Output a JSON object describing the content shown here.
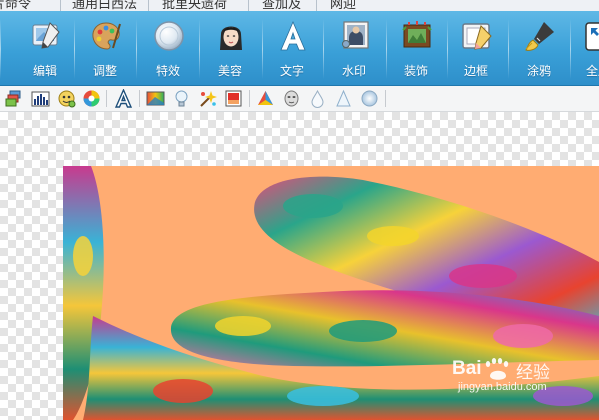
{
  "menu": {
    "items": [
      "片命令",
      "通用白西法",
      "批里央遗荷",
      "查加及",
      "网迎"
    ]
  },
  "toolbar": {
    "buttons": [
      {
        "label": "编辑",
        "icon": "edit-pen-icon"
      },
      {
        "label": "调整",
        "icon": "palette-icon"
      },
      {
        "label": "特效",
        "icon": "effects-lens-icon"
      },
      {
        "label": "美容",
        "icon": "beauty-face-icon"
      },
      {
        "label": "文字",
        "icon": "text-a-icon"
      },
      {
        "label": "水印",
        "icon": "watermark-stamp-icon"
      },
      {
        "label": "装饰",
        "icon": "decoration-frame-icon"
      },
      {
        "label": "边框",
        "icon": "border-frame-icon"
      },
      {
        "label": "涂鸦",
        "icon": "doodle-brush-icon"
      },
      {
        "label": "全屏",
        "icon": "fullscreen-icon"
      }
    ]
  },
  "subtoolbar": {
    "icons": [
      "layers-icon",
      "histogram-icon",
      "color-balance-icon",
      "color-wheel-icon",
      "text-outline-icon",
      "gradient-icon",
      "light-bulb-icon",
      "sparkle-icon",
      "red-square-icon",
      "color-triangle-icon",
      "face-mask-icon",
      "drop-icon",
      "cone-icon",
      "blur-circle-icon"
    ]
  },
  "watermark": {
    "brand": "Bai",
    "brand_suffix": "经验",
    "url": "jingyan.baidu.com"
  },
  "colors": {
    "toolbar": "#3aa0d8",
    "photo_background": "#ffac72"
  }
}
